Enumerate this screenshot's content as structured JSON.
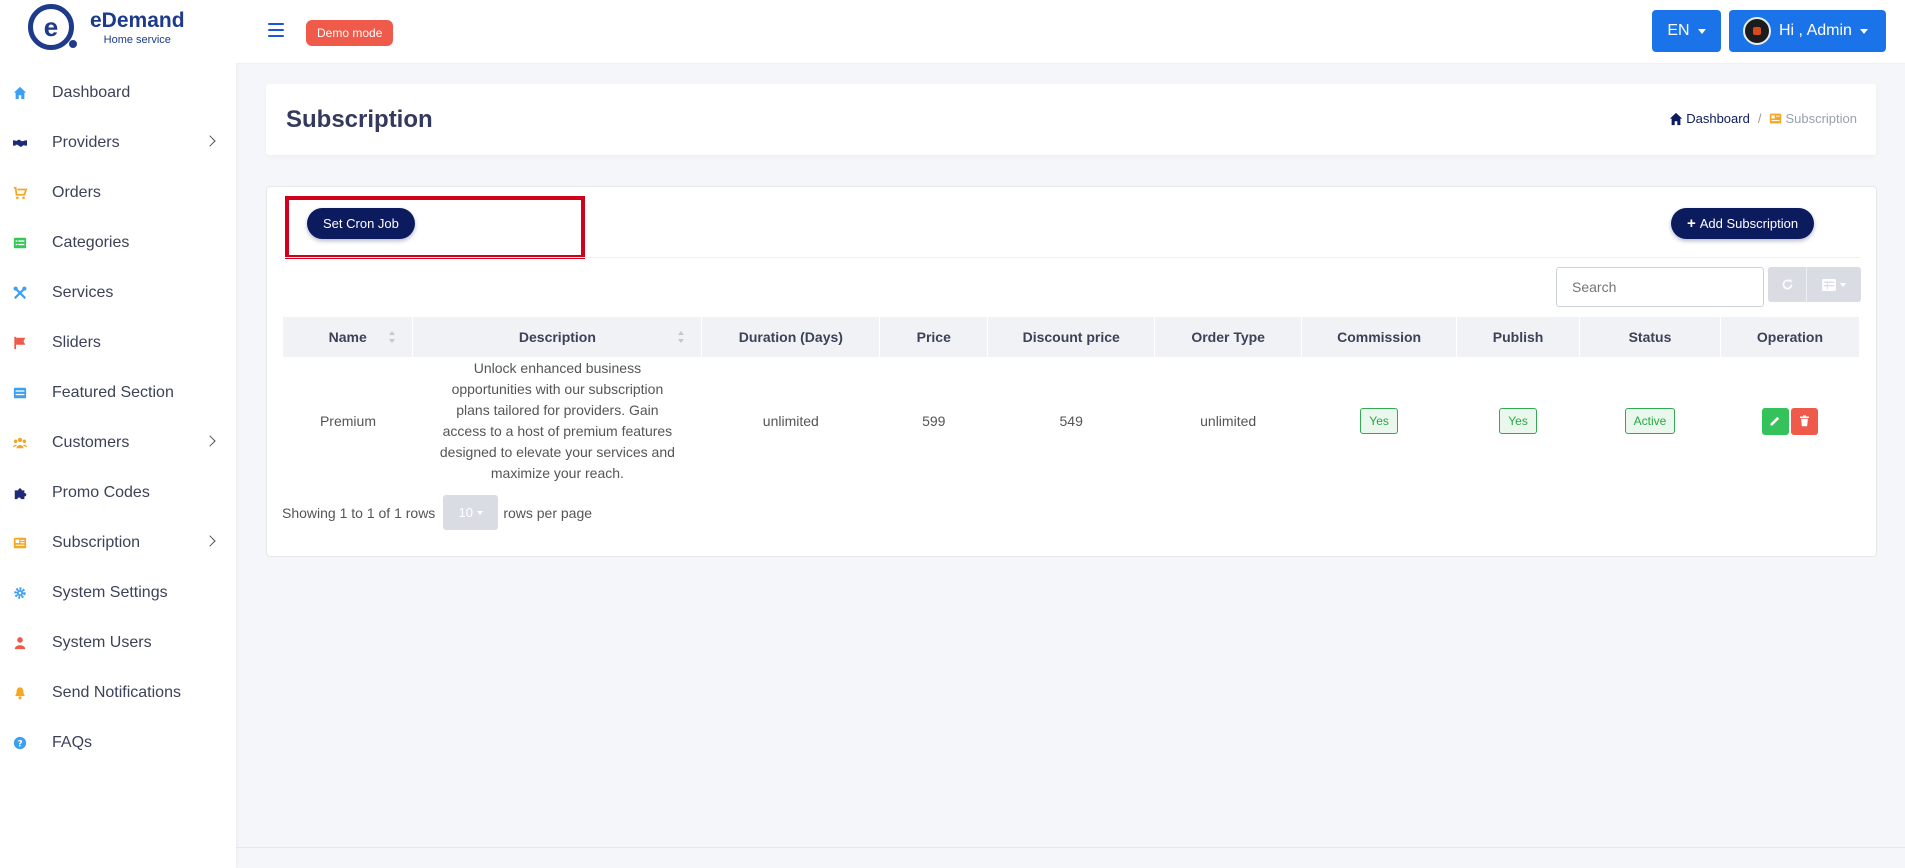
{
  "brand": {
    "name": "eDemand",
    "subtitle": "Home service",
    "logo_letter": "e"
  },
  "sidebar": {
    "items": [
      {
        "label": "Dashboard",
        "icon": "home-icon",
        "color": "#3b9ff3",
        "has_submenu": false
      },
      {
        "label": "Providers",
        "icon": "handshake-icon",
        "color": "#1e2a78",
        "has_submenu": true
      },
      {
        "label": "Orders",
        "icon": "cart-icon",
        "color": "#f5a623",
        "has_submenu": false
      },
      {
        "label": "Categories",
        "icon": "list-icon",
        "color": "#34c759",
        "has_submenu": false
      },
      {
        "label": "Services",
        "icon": "tools-icon",
        "color": "#3b9ff3",
        "has_submenu": false
      },
      {
        "label": "Sliders",
        "icon": "flag-icon",
        "color": "#f05a4a",
        "has_submenu": false
      },
      {
        "label": "Featured Section",
        "icon": "list-alt-icon",
        "color": "#3b9ff3",
        "has_submenu": false
      },
      {
        "label": "Customers",
        "icon": "users-icon",
        "color": "#f5a623",
        "has_submenu": true
      },
      {
        "label": "Promo Codes",
        "icon": "puzzle-icon",
        "color": "#1e2a78",
        "has_submenu": false
      },
      {
        "label": "Subscription",
        "icon": "newspaper-icon",
        "color": "#f5a623",
        "has_submenu": true
      },
      {
        "label": "System Settings",
        "icon": "gear-icon",
        "color": "#3b9ff3",
        "has_submenu": false
      },
      {
        "label": "System Users",
        "icon": "user-icon",
        "color": "#f05a4a",
        "has_submenu": false
      },
      {
        "label": "Send Notifications",
        "icon": "bell-icon",
        "color": "#f5a623",
        "has_submenu": false
      },
      {
        "label": "FAQs",
        "icon": "question-icon",
        "color": "#3b9ff3",
        "has_submenu": false
      }
    ]
  },
  "topbar": {
    "demo_label": "Demo mode",
    "language": "EN",
    "user_greeting": "Hi , Admin"
  },
  "header": {
    "title": "Subscription",
    "breadcrumb": {
      "home": "Dashboard",
      "current": "Subscription"
    }
  },
  "toolbar": {
    "cron_label": "Set Cron Job",
    "add_label": "Add Subscription",
    "search_placeholder": "Search"
  },
  "table": {
    "columns": [
      "Name",
      "Description",
      "Duration (Days)",
      "Price",
      "Discount price",
      "Order Type",
      "Commission",
      "Publish",
      "Status",
      "Operation"
    ],
    "rows": [
      {
        "name": "Premium",
        "description": "Unlock enhanced business opportunities with our subscription plans tailored for providers. Gain access to a host of premium features designed to elevate your services and maximize your reach.",
        "duration": "unlimited",
        "price": "599",
        "discount_price": "549",
        "order_type": "unlimited",
        "commission": "Yes",
        "publish": "Yes",
        "status": "Active"
      }
    ]
  },
  "pagination": {
    "showing": "Showing 1 to 1 of 1 rows",
    "page_size": "10",
    "rows_per_page": "rows per page"
  },
  "colors": {
    "primary": "#0c1a5e",
    "accent_blue": "#1a73e8",
    "danger": "#f05a4a",
    "success": "#35c25a",
    "highlight_box": "#d0021b"
  }
}
